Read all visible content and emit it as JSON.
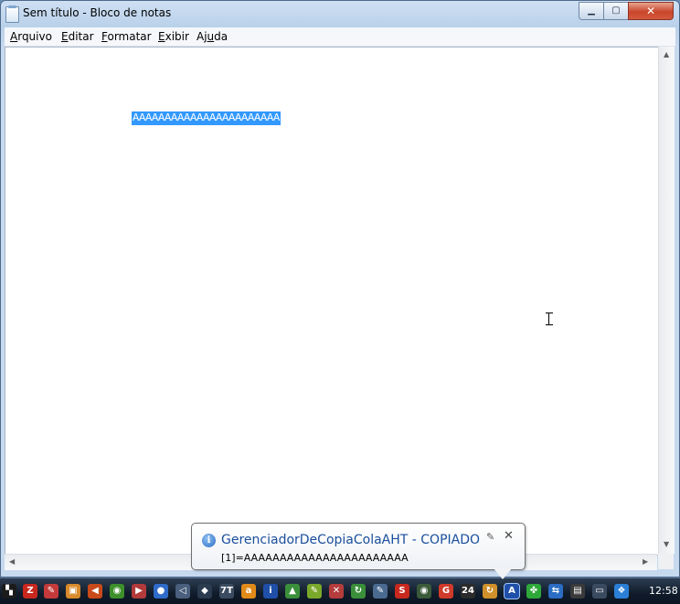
{
  "window": {
    "title": "Sem título - Bloco de notas",
    "minimize_icon": "minimize-icon",
    "maximize_icon": "maximize-icon",
    "close_icon": "close-icon"
  },
  "menu": {
    "items": [
      {
        "pre": "",
        "ul": "A",
        "post": "rquivo"
      },
      {
        "pre": "",
        "ul": "E",
        "post": "ditar"
      },
      {
        "pre": "",
        "ul": "F",
        "post": "ormatar"
      },
      {
        "pre": "",
        "ul": "E",
        "post": "xibir"
      },
      {
        "pre": "Aj",
        "ul": "u",
        "post": "da"
      }
    ]
  },
  "editor": {
    "content": "AAAAAAAAAAAAAAAAAAAAAAA"
  },
  "balloon": {
    "title": "GerenciadorDeCopiaColaAHT - COPIADO",
    "body": "[1]=AAAAAAAAAAAAAAAAAAAAAAA",
    "info_icon": "info-icon"
  },
  "taskbar": {
    "clock": "12:58",
    "icons": [
      {
        "name": "start-icon",
        "glyph": "▚",
        "color": "#1b1b1b"
      },
      {
        "name": "filezilla-icon",
        "glyph": "Z",
        "color": "#c8281e"
      },
      {
        "name": "tool-icon",
        "glyph": "✎",
        "color": "#c43a3a"
      },
      {
        "name": "package-icon",
        "glyph": "▣",
        "color": "#d98a2b"
      },
      {
        "name": "speaker-icon",
        "glyph": "◀",
        "color": "#c84a1a"
      },
      {
        "name": "nvidia-icon",
        "glyph": "◉",
        "color": "#3d8f2a"
      },
      {
        "name": "media-icon",
        "glyph": "▶",
        "color": "#b23a3a"
      },
      {
        "name": "globe-icon",
        "glyph": "●",
        "color": "#2f6bc9"
      },
      {
        "name": "volume-icon",
        "glyph": "◁",
        "color": "#4a5f7d"
      },
      {
        "name": "dropbox-small-icon",
        "glyph": "◆",
        "color": "#2a3a4f"
      },
      {
        "name": "font-icon",
        "glyph": "7T",
        "color": "#3b4b60"
      },
      {
        "name": "avast-icon",
        "glyph": "a",
        "color": "#e08a1a"
      },
      {
        "name": "intel-icon",
        "glyph": "i",
        "color": "#1f4fa8"
      },
      {
        "name": "drive-icon",
        "glyph": "▲",
        "color": "#3b8f3b"
      },
      {
        "name": "edit-icon",
        "glyph": "✎",
        "color": "#7aa82a"
      },
      {
        "name": "office-icon",
        "glyph": "✕",
        "color": "#b43c3c"
      },
      {
        "name": "sync-icon",
        "glyph": "↻",
        "color": "#3b8f3b"
      },
      {
        "name": "document-icon",
        "glyph": "✎",
        "color": "#4b6a8f"
      },
      {
        "name": "skype-icon",
        "glyph": "S",
        "color": "#c8281e"
      },
      {
        "name": "eye-icon",
        "glyph": "◉",
        "color": "#3a5a3a"
      },
      {
        "name": "g-icon",
        "glyph": "G",
        "color": "#d03a2a"
      },
      {
        "name": "calendar-icon",
        "glyph": "24",
        "color": "#2b2b2b"
      },
      {
        "name": "refresh-icon",
        "glyph": "↻",
        "color": "#d0902a"
      },
      {
        "name": "copy-tool-icon",
        "glyph": "A",
        "color": "#1f4fa8"
      },
      {
        "name": "clover-icon",
        "glyph": "✤",
        "color": "#2fa83a"
      },
      {
        "name": "network-icon",
        "glyph": "⇆",
        "color": "#2b6cc4"
      },
      {
        "name": "printer-icon",
        "glyph": "▤",
        "color": "#3a3a3a"
      },
      {
        "name": "window-icon",
        "glyph": "▭",
        "color": "#3a4a5f"
      },
      {
        "name": "dropbox-icon",
        "glyph": "❖",
        "color": "#2b7fd6"
      }
    ]
  }
}
